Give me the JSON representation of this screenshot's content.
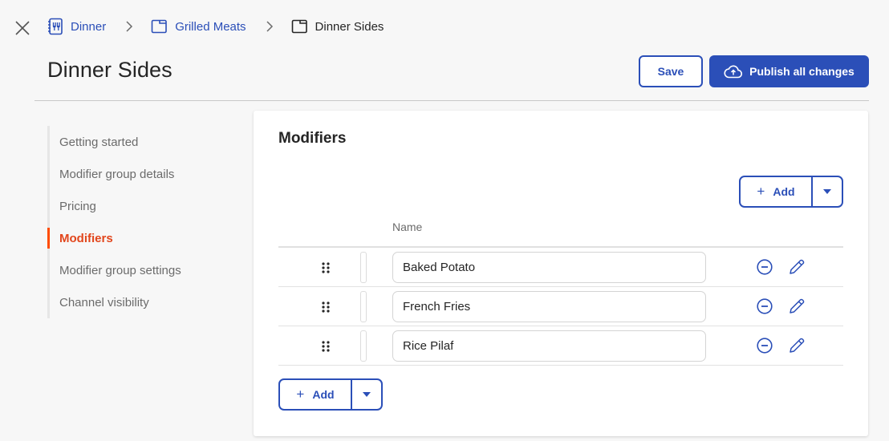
{
  "breadcrumb": {
    "items": [
      {
        "label": "Dinner",
        "icon": "menu-icon"
      },
      {
        "label": "Grilled Meats",
        "icon": "folder-icon"
      },
      {
        "label": "Dinner Sides",
        "icon": "folder-icon"
      }
    ]
  },
  "header": {
    "title": "Dinner Sides",
    "save_label": "Save",
    "publish_label": "Publish all changes"
  },
  "sidebar": {
    "items": [
      {
        "label": "Getting started",
        "active": false
      },
      {
        "label": "Modifier group details",
        "active": false
      },
      {
        "label": "Pricing",
        "active": false
      },
      {
        "label": "Modifiers",
        "active": true
      },
      {
        "label": "Modifier group settings",
        "active": false
      },
      {
        "label": "Channel visibility",
        "active": false
      }
    ]
  },
  "modifiers": {
    "title": "Modifiers",
    "add_label": "Add",
    "add_plus": "+",
    "column_name": "Name",
    "rows": [
      {
        "name": "Baked Potato"
      },
      {
        "name": "French Fries"
      },
      {
        "name": "Rice Pilaf"
      }
    ]
  },
  "colors": {
    "primary": "#2b4fb8",
    "active_nav": "#e2461c",
    "active_indicator": "#ff4c00",
    "background": "#f7f7f7"
  }
}
